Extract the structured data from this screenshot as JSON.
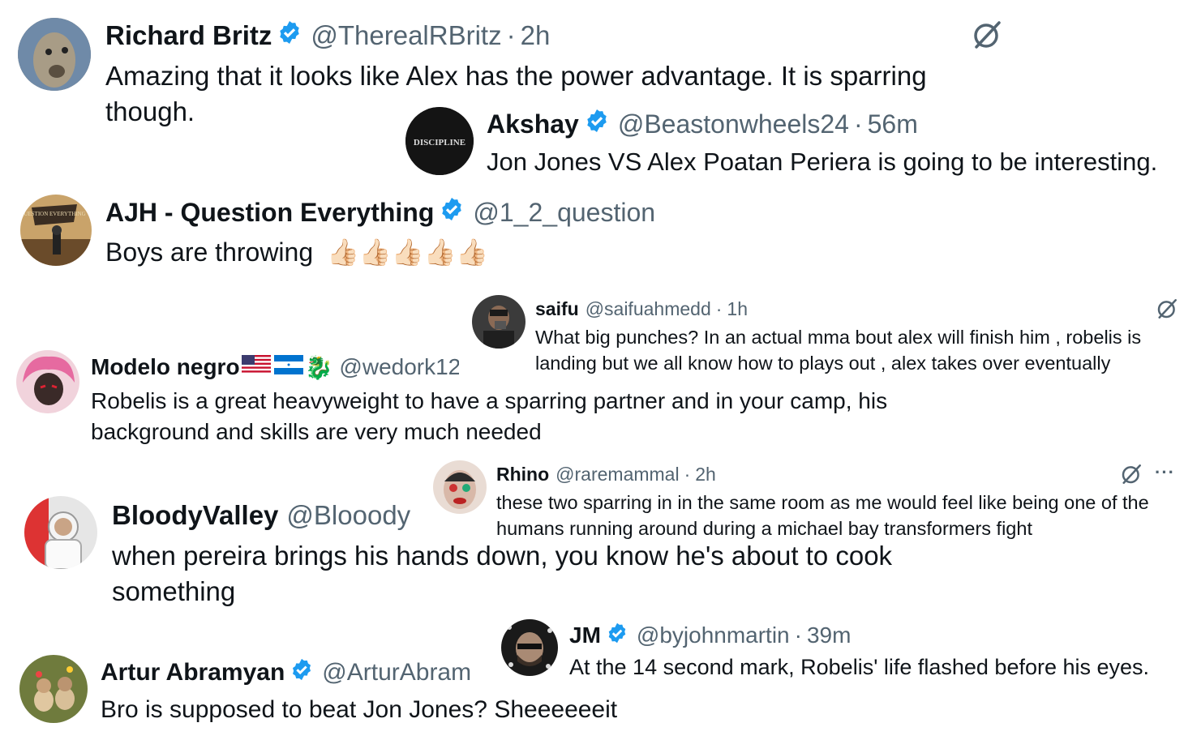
{
  "tweets": [
    {
      "name": "Richard Britz",
      "verified": true,
      "handle": "@TherealRBritz",
      "time": "2h",
      "text": "Amazing that it looks like Alex has the power advantage. It is sparring though."
    },
    {
      "name": "Akshay",
      "verified": true,
      "handle": "@Beastonwheels24",
      "time": "56m",
      "text": "Jon Jones VS Alex Poatan Periera is going to be interesting.",
      "avatar_text": "DISCIPLINE"
    },
    {
      "name": "AJH - Question Everything",
      "verified": true,
      "handle": "@1_2_question",
      "time": "",
      "text": "Boys are throwing",
      "emoji": "👍🏻👍🏻👍🏻👍🏻👍🏻",
      "avatar_text": "QUESTION EVERYTHING"
    },
    {
      "name": "saifu",
      "verified": false,
      "handle": "@saifuahmedd",
      "time": "1h",
      "text": "What big punches? In an actual mma bout alex will finish him , robelis is landing but we all know how to plays out , alex takes over eventually"
    },
    {
      "name": "Modelo negro",
      "verified": false,
      "handle": "@wedork12",
      "time": "",
      "text": "Robelis is a great heavyweight to have a sparring partner and in your camp, his background and skills are very much needed",
      "emoji": "🐉"
    },
    {
      "name": "Rhino",
      "verified": false,
      "handle": "@raremammal",
      "time": "2h",
      "text": "these two sparring in in the same room as me would feel like being one of the humans running around during a michael bay transformers fight"
    },
    {
      "name": "BloodyValley",
      "verified": false,
      "handle": "@Blooody",
      "time": "",
      "text": "when pereira brings his hands down, you know he's about to cook something"
    },
    {
      "name": "JM",
      "verified": true,
      "handle": "@byjohnmartin",
      "time": "39m",
      "text": "At the 14 second mark, Robelis' life flashed before his eyes."
    },
    {
      "name": "Artur Abramyan",
      "verified": true,
      "handle": "@ArturAbram",
      "time": "",
      "text": "Bro is supposed to beat Jon Jones? Sheeeeeeit"
    }
  ],
  "icons": {
    "grok": "grok-slash-icon",
    "more": "···",
    "badge_color": "#1d9bf0"
  }
}
